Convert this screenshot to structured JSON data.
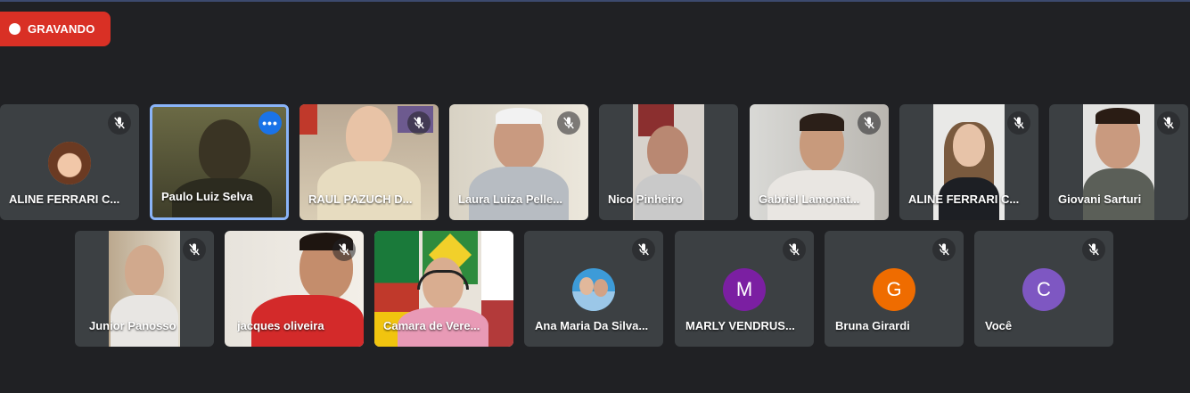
{
  "recording": {
    "label": "GRAVANDO"
  },
  "participants": [
    {
      "name": "ALINE FERRARI C...",
      "initial": "",
      "color": "",
      "muted": true
    },
    {
      "name": "Paulo Luiz Selva",
      "initial": "",
      "color": "",
      "muted": false,
      "active": true
    },
    {
      "name": "RAUL PAZUCH D...",
      "initial": "",
      "color": "",
      "muted": true
    },
    {
      "name": "Laura Luiza Pelle...",
      "initial": "",
      "color": "",
      "muted": true
    },
    {
      "name": "Nico Pinheiro",
      "initial": "",
      "color": "",
      "muted": false
    },
    {
      "name": "Gabriel Lamonat...",
      "initial": "",
      "color": "",
      "muted": true
    },
    {
      "name": "ALINE FERRARI C...",
      "initial": "",
      "color": "",
      "muted": true
    },
    {
      "name": "Giovani Sarturi",
      "initial": "",
      "color": "",
      "muted": true
    },
    {
      "name": "Junior Panosso",
      "initial": "",
      "color": "",
      "muted": true
    },
    {
      "name": "jacques oliveira",
      "initial": "",
      "color": "",
      "muted": true
    },
    {
      "name": "Camara de Vere...",
      "initial": "",
      "color": "",
      "muted": false
    },
    {
      "name": "Ana Maria Da Silva...",
      "initial": "",
      "color": "",
      "muted": true
    },
    {
      "name": "MARLY VENDRUS...",
      "initial": "M",
      "color": "#7b1fa2",
      "muted": true
    },
    {
      "name": "Bruna Girardi",
      "initial": "G",
      "color": "#ef6c00",
      "muted": true
    },
    {
      "name": "Você",
      "initial": "C",
      "color": "#7e57c2",
      "muted": true
    }
  ]
}
